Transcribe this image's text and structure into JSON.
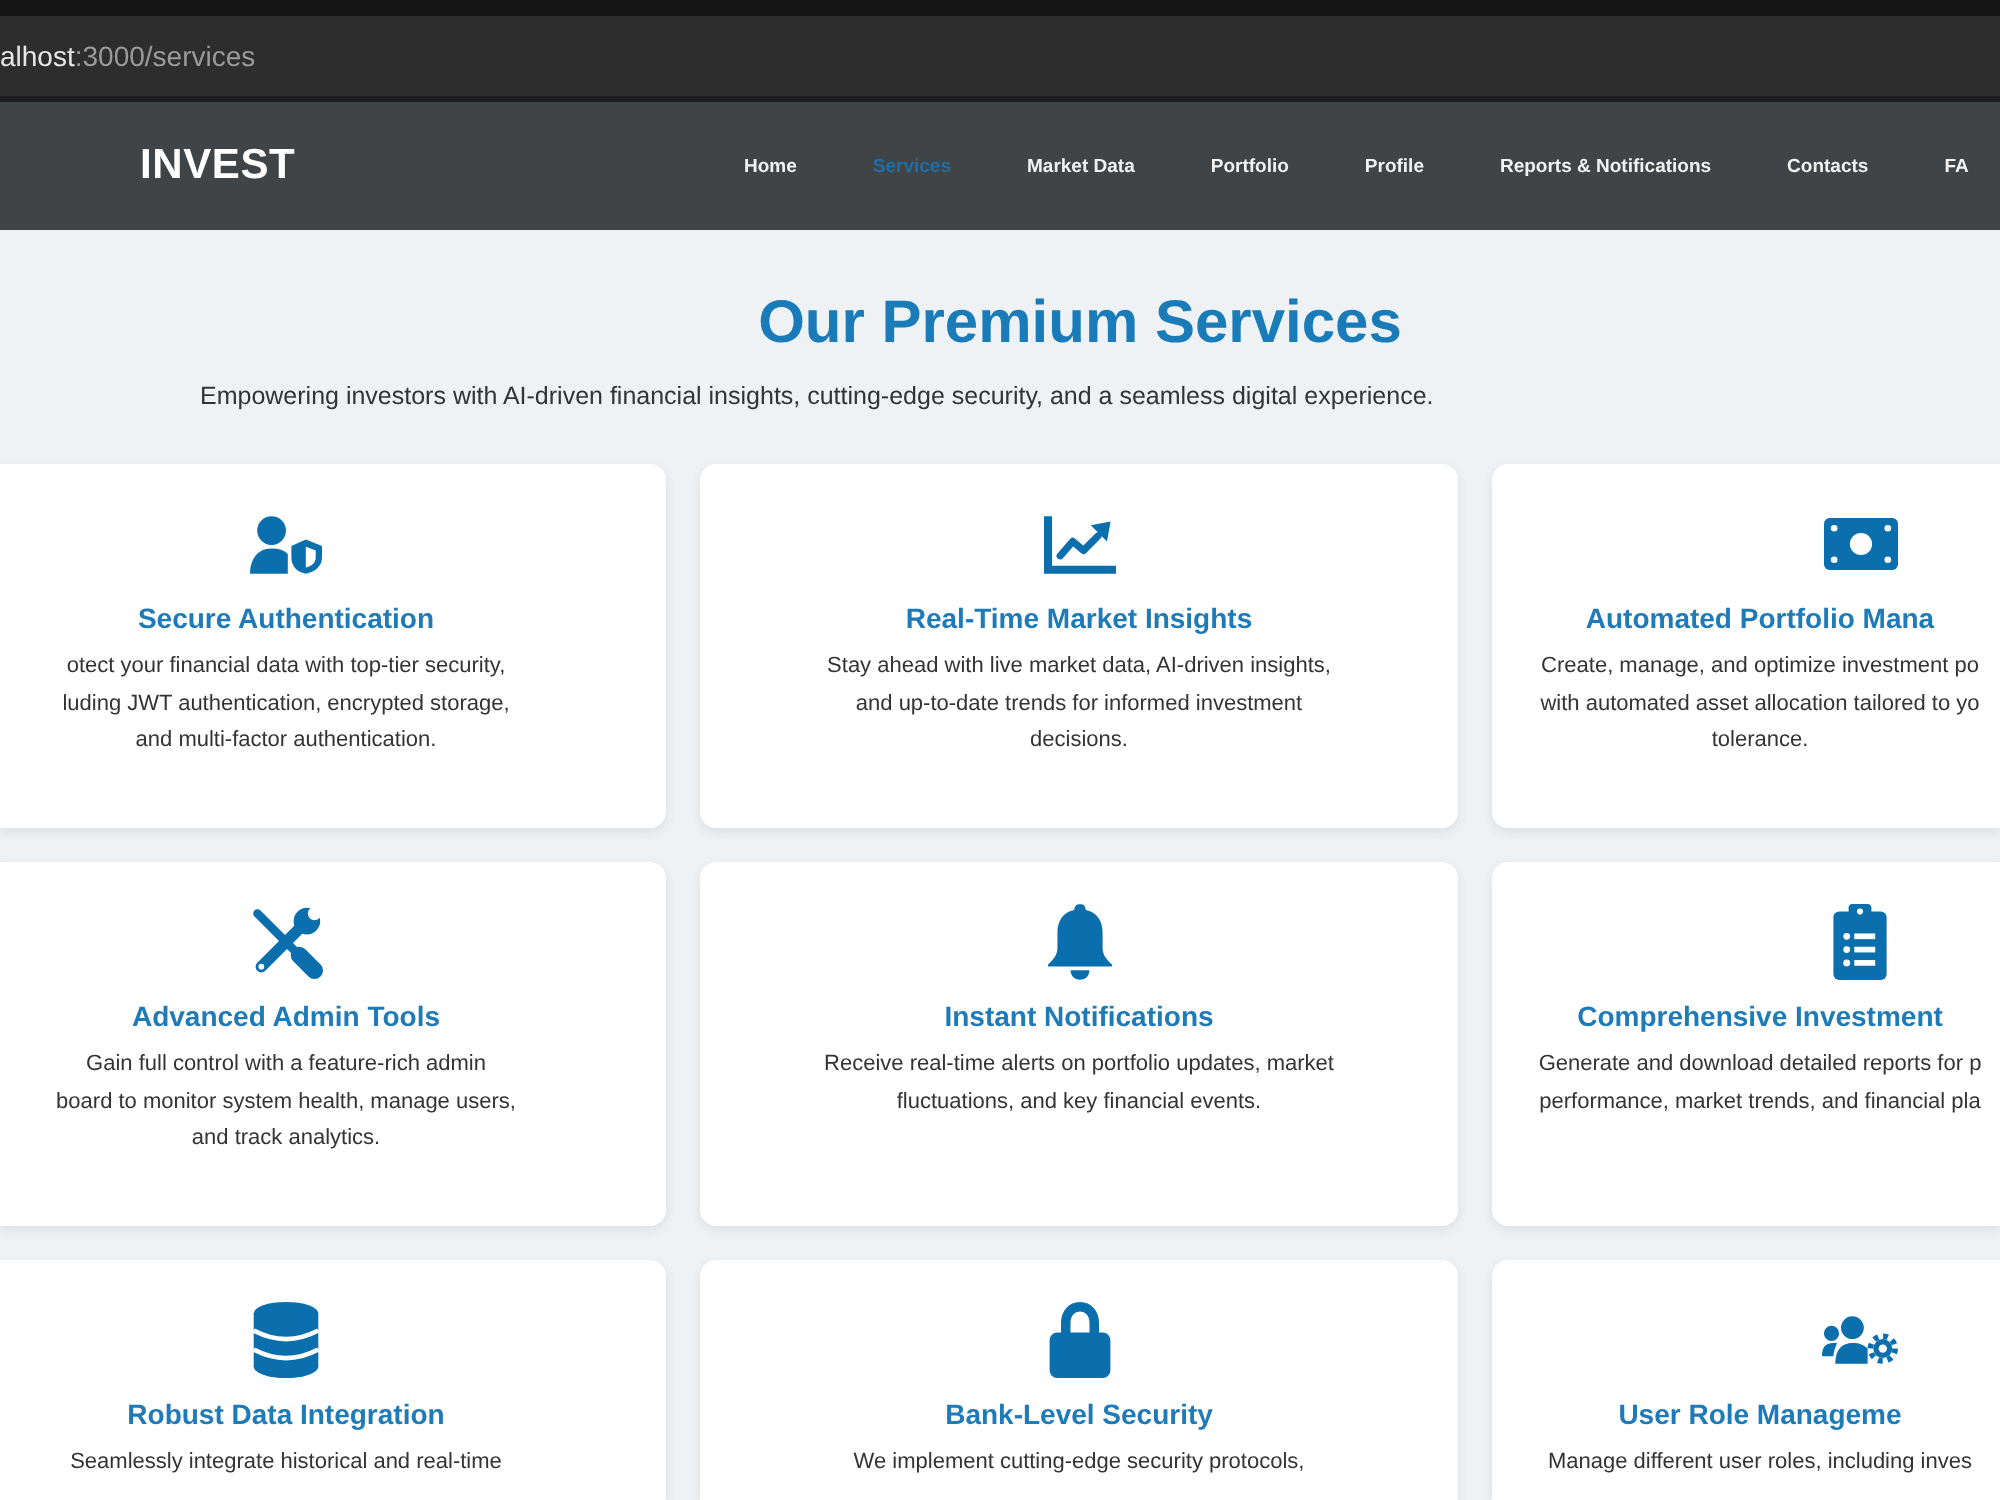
{
  "browser": {
    "url_host": "alhost",
    "url_path": ":3000/services"
  },
  "navbar": {
    "logo": "INVEST",
    "items": [
      {
        "label": "Home",
        "selected": false
      },
      {
        "label": "Services",
        "selected": true
      },
      {
        "label": "Market Data",
        "selected": false
      },
      {
        "label": "Portfolio",
        "selected": false
      },
      {
        "label": "Profile",
        "selected": false
      },
      {
        "label": "Reports & Notifications",
        "selected": false
      },
      {
        "label": "Contacts",
        "selected": false
      },
      {
        "label": "FA",
        "selected": false
      }
    ]
  },
  "hero": {
    "title": "Our Premium Services",
    "subtitle": "Empowering investors with AI-driven financial insights, cutting-edge security, and a seamless digital experience."
  },
  "services": [
    {
      "title": "Secure Authentication",
      "description": "otect your financial data with top-tier security,\nluding JWT authentication, encrypted storage,\nand multi-factor authentication."
    },
    {
      "title": "Real-Time Market Insights",
      "description": "Stay ahead with live market data, AI-driven insights,\nand up-to-date trends for informed investment\ndecisions."
    },
    {
      "title": "Automated Portfolio Mana",
      "description": "Create, manage, and optimize investment po\nwith automated asset allocation tailored to yo\ntolerance."
    },
    {
      "title": "Advanced Admin Tools",
      "description": "Gain full control with a feature-rich admin\nboard to monitor system health, manage users,\nand track analytics."
    },
    {
      "title": "Instant Notifications",
      "description": "Receive real-time alerts on portfolio updates, market\nfluctuations, and key financial events."
    },
    {
      "title": "Comprehensive Investment",
      "description": "Generate and download detailed reports for p\nperformance, market trends, and financial pla"
    },
    {
      "title": "Robust Data Integration",
      "description": "Seamlessly integrate historical and real-time"
    },
    {
      "title": "Bank-Level Security",
      "description": "We implement cutting-edge security protocols,"
    },
    {
      "title": "User Role Manageme",
      "description": "Manage different user roles, including inves"
    }
  ]
}
